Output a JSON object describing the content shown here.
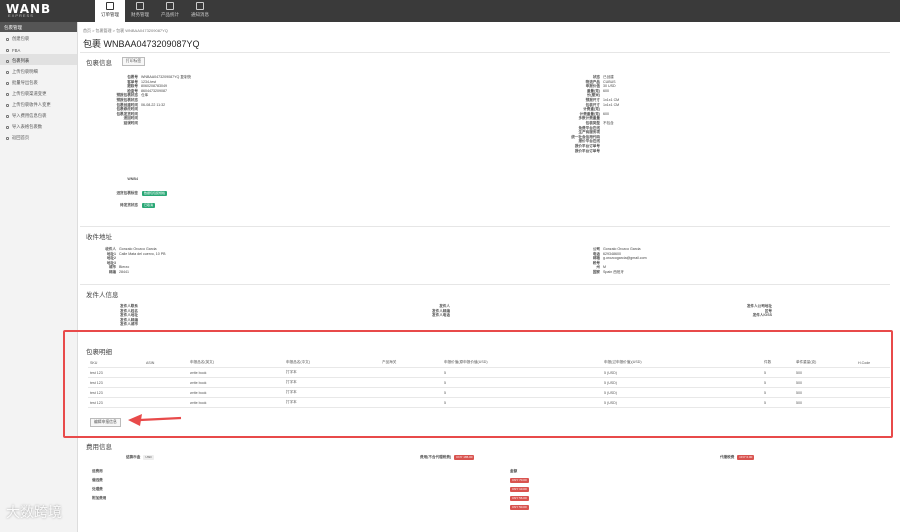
{
  "app": {
    "logo": "WANB",
    "logo_sub": "EXPRESS"
  },
  "topnav": [
    {
      "label": "订单管理",
      "active": true
    },
    {
      "label": "财务管理",
      "active": false
    },
    {
      "label": "产品统计",
      "active": false
    },
    {
      "label": "通知消息",
      "active": false
    }
  ],
  "sidebar": {
    "title": "包裹管理",
    "items": [
      {
        "label": "创建包裹"
      },
      {
        "label": "FBA"
      },
      {
        "label": "包裹列表",
        "active": true
      },
      {
        "label": "上传包裹明细"
      },
      {
        "label": "批量导出包裹"
      },
      {
        "label": "上传包裹渠道变更"
      },
      {
        "label": "上传包裹收件人变更"
      },
      {
        "label": "导入费用信息包裹"
      },
      {
        "label": "导入表格包裹数"
      },
      {
        "label": "返回首页"
      }
    ]
  },
  "breadcrumb": "首页 > 包裹管理 > 包裹 WNBAA0473209087YQ",
  "page_title": "包裹 WNBAA0473209087YQ",
  "parcel_info": {
    "heading": "包裹信息",
    "print_button": "打印标签",
    "left": [
      {
        "k": "包裹号",
        "v": "WNBAA0473209087YQ 复制快"
      },
      {
        "k": "客单号",
        "v": "1234-test"
      },
      {
        "k": "跟踪号",
        "v": "8060208783049"
      },
      {
        "k": "检查号",
        "v": "8604473209087"
      },
      {
        "k": "预报包裹状态",
        "v": "仓库"
      },
      {
        "k": "预报包裹状态",
        "v": ""
      },
      {
        "k": "包裹创建时间",
        "v": "06-08-22 11:32"
      },
      {
        "k": "包裹修改时间",
        "v": ""
      },
      {
        "k": "包裹发货时间",
        "v": ""
      },
      {
        "k": "退回时间",
        "v": ""
      },
      {
        "k": "延误时间",
        "v": ""
      }
    ],
    "right": [
      {
        "k": "状态",
        "v": "已创建"
      },
      {
        "k": "物流产品",
        "v": "CUBUS"
      },
      {
        "k": "申报价值",
        "v": "30 USD"
      },
      {
        "k": "重量(克)",
        "v": "600"
      },
      {
        "k": "长(厘米)",
        "v": ""
      },
      {
        "k": "预报尺寸",
        "v": "1x1x1 CM"
      },
      {
        "k": "包装尺寸",
        "v": "1x1x1 CM"
      },
      {
        "k": "计费重(克)",
        "v": ""
      },
      {
        "k": "计费重量(克)",
        "v": "600"
      },
      {
        "k": "多数计费重量",
        "v": ""
      },
      {
        "k": "包装类型",
        "v": "不包含"
      },
      {
        "k": "免费平台在线",
        "v": ""
      },
      {
        "k": "生产商服务项",
        "v": ""
      },
      {
        "k": "统一社会信用代码",
        "v": ""
      },
      {
        "k": "报价平台在线",
        "v": ""
      },
      {
        "k": "报价平台订单号",
        "v": ""
      },
      {
        "k": "报价平台订单号",
        "v": ""
      }
    ],
    "wnb_label": "WNB4",
    "tag1_key": "进货包裹标签",
    "tag1": "数据包包装规格",
    "tag2_key": "待发货状态",
    "tag2": "已取消"
  },
  "recipient": {
    "heading": "收件地址",
    "left": [
      {
        "k": "收件人",
        "v": "Gonzalo Orozco Garcia"
      },
      {
        "k": "地址1",
        "v": "Calle Mata del cuervo, 10 PB"
      },
      {
        "k": "地址2",
        "v": ""
      },
      {
        "k": "地址3",
        "v": ""
      },
      {
        "k": "城市",
        "v": "Bierzo"
      },
      {
        "k": "邮编",
        "v": "28441"
      }
    ],
    "right": [
      {
        "k": "公司",
        "v": "Gonzalo Orozco Garcia"
      },
      {
        "k": "电话",
        "v": "629348600"
      },
      {
        "k": "邮箱",
        "v": "g.orozcogarcia@gmail.com"
      },
      {
        "k": "税号",
        "v": ""
      },
      {
        "k": "州",
        "v": "M"
      },
      {
        "k": "国家",
        "v": "Spain 西班牙"
      }
    ]
  },
  "sender": {
    "heading": "发件人信息",
    "col1": [
      "发件人联系",
      "发件人姓名",
      "发件人地址",
      "发件人邮编",
      "发件人城市"
    ],
    "col2": [
      "发件人",
      "发件人邮编",
      "发件人电话"
    ],
    "col3": [
      "发件人公司地址",
      "区号",
      "发件人IOSS"
    ]
  },
  "details": {
    "heading": "包裹明细",
    "columns": [
      "SKU",
      "ASIN",
      "申报品名(英文)",
      "申报品名(中文)",
      "产品海关",
      "申报价值(原申报价值(USD)",
      "申报(过申报价值)(USD)",
      "件数",
      "单件重量(克)",
      "H.Code"
    ],
    "rows": [
      [
        "test 123",
        "",
        "write book",
        "打字本",
        "",
        "5",
        "5 (USD)",
        "5",
        "500",
        ""
      ],
      [
        "test 123",
        "",
        "write book",
        "打字本",
        "",
        "5",
        "5 (USD)",
        "5",
        "500",
        ""
      ],
      [
        "test 123",
        "",
        "write book",
        "打字本",
        "",
        "5",
        "5 (USD)",
        "5",
        "500",
        ""
      ],
      [
        "test 123",
        "",
        "write book",
        "打字本",
        "",
        "5",
        "5 (USD)",
        "5",
        "500",
        ""
      ]
    ],
    "edit_button": "编辑申报信息"
  },
  "fees": {
    "heading": "费用信息",
    "row1": [
      {
        "k": "结算币金",
        "v": "USD"
      },
      {
        "k": "费用(不含代理税费)",
        "v": "CNY 186.00"
      },
      {
        "k": "代缴税费",
        "v": "CNY 0.00"
      }
    ],
    "left": [
      "运费用",
      "偏远费",
      "处理费",
      "附加费用"
    ],
    "right_label": "金额",
    "amounts": [
      "CNY 70.00",
      "CNY 10.00",
      "CNY 56.00",
      "CNY 50.00"
    ]
  },
  "colors": {
    "accent": "#e84a4a",
    "tag_green": "#2aa876",
    "tag_red": "#d9534f"
  },
  "watermark": "大数跨境"
}
